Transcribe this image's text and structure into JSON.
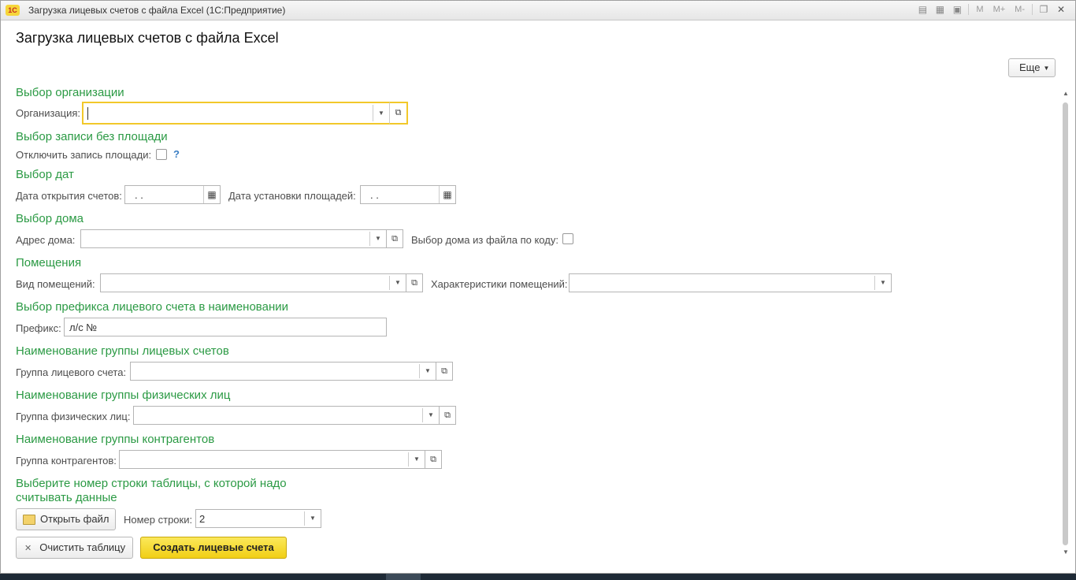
{
  "window": {
    "title": "Загрузка лицевых счетов с файла Excel  (1С:Предприятие)",
    "app_logo": "1С",
    "toolbar_memory": [
      "M",
      "M+",
      "M-"
    ]
  },
  "form": {
    "title": "Загрузка лицевых счетов с файла Excel",
    "more_button": "Еще"
  },
  "org": {
    "group_title": "Выбор организации",
    "label": "Организация:",
    "value": ""
  },
  "area": {
    "group_title": "Выбор записи без площади",
    "label": "Отключить запись площади:",
    "checked": false,
    "help": "?"
  },
  "dates": {
    "group_title": "Выбор дат",
    "open_label": "Дата открытия счетов:",
    "open_value": " .  .",
    "area_label": "Дата установки площадей:",
    "area_value": " .  ."
  },
  "house": {
    "group_title": "Выбор дома",
    "address_label": "Адрес дома:",
    "address_value": "",
    "by_code_label": "Выбор дома из файла по коду:",
    "by_code_checked": false
  },
  "rooms": {
    "group_title": "Помещения",
    "type_label": "Вид помещений:",
    "type_value": "",
    "chars_label": "Характеристики помещений:",
    "chars_value": ""
  },
  "prefix": {
    "group_title": "Выбор префикса лицевого счета в наименовании",
    "label": "Префикс:",
    "value": "л/с №"
  },
  "acc_group": {
    "group_title": "Наименование группы лицевых счетов",
    "label": "Группа лицевого счета:",
    "value": ""
  },
  "person_group": {
    "group_title": "Наименование группы физических лиц",
    "label": "Группа физических лиц:",
    "value": ""
  },
  "contr_group": {
    "group_title": "Наименование группы контрагентов",
    "label": "Группа контрагентов:",
    "value": ""
  },
  "row_select": {
    "group_title_line1": "Выберите номер строки таблицы, с которой надо",
    "group_title_line2": "считывать данные",
    "open_file_button": "Открыть файл",
    "row_label": "Номер строки:",
    "row_value": "2"
  },
  "actions": {
    "clear_button": "Очистить таблицу",
    "create_button": "Создать лицевые счета"
  },
  "colors": {
    "group_title": "#2b9a44",
    "primary_button": "#f1cf16",
    "focus_border": "#f2c82a"
  },
  "icons": {
    "dropdown": "chevron-down-icon",
    "open": "open-window-icon",
    "calendar": "calendar-icon",
    "folder": "folder-icon",
    "clear": "close-icon"
  }
}
